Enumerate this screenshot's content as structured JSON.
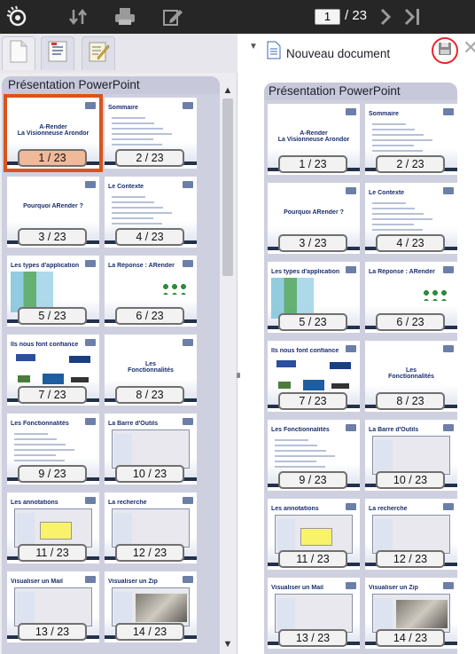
{
  "toolbar": {
    "logo_icon": "eye-logo-icon",
    "page_input": "1",
    "page_total": "/ 23"
  },
  "left": {
    "group_title": "Présentation PowerPoint"
  },
  "right": {
    "doc_title": "Nouveau document",
    "group_title": "Présentation PowerPoint"
  },
  "slides": [
    {
      "label": "1 / 23",
      "kind": "title",
      "title": "A-Render\nLa Visionneuse Arondor"
    },
    {
      "label": "2 / 23",
      "kind": "list",
      "title": "Sommaire"
    },
    {
      "label": "3 / 23",
      "kind": "title",
      "title": "Pourquoi ARender ?"
    },
    {
      "label": "4 / 23",
      "kind": "list",
      "title": "Le Contexte"
    },
    {
      "label": "5 / 23",
      "kind": "diagram",
      "title": "Les types d'application"
    },
    {
      "label": "6 / 23",
      "kind": "dots",
      "title": "La Réponse : ARender"
    },
    {
      "label": "7 / 23",
      "kind": "logos",
      "title": "Ils nous font confiance"
    },
    {
      "label": "8 / 23",
      "kind": "title",
      "title": "Les\nFonctionnalités"
    },
    {
      "label": "9 / 23",
      "kind": "list",
      "title": "Les Fonctionnalités"
    },
    {
      "label": "10 / 23",
      "kind": "shot",
      "title": "La Barre d'Outils"
    },
    {
      "label": "11 / 23",
      "kind": "yellow",
      "title": "Les annotations"
    },
    {
      "label": "12 / 23",
      "kind": "shot",
      "title": "La recherche"
    },
    {
      "label": "13 / 23",
      "kind": "shot",
      "title": "Visualiser un Mail"
    },
    {
      "label": "14 / 23",
      "kind": "photo",
      "title": "Visualiser un Zip"
    }
  ]
}
